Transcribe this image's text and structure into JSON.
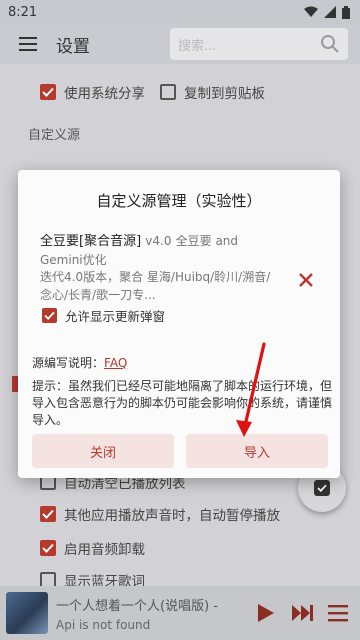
{
  "status": {
    "time": "8:21"
  },
  "appbar": {
    "title": "设置",
    "search_placeholder": "搜索..."
  },
  "settings": {
    "share_system": "使用系统分享",
    "copy_clipboard": "复制到剪贴板",
    "custom_source_title": "自定义源",
    "auto_clear": "自动清空已播放列表",
    "pause_other_app": "其他应用播放声音时，自动暂停播放",
    "enable_uninstall": "启用音频卸载",
    "show_bluetooth_lyric": "显示蓝牙歌词"
  },
  "dialog": {
    "title": "自定义源管理（实验性）",
    "source": {
      "name": "全豆要[聚合音源]",
      "version": "v4.0",
      "author": "全豆要 and Gemini优化",
      "description": "迭代4.0版本，聚合 星海/Huibq/聆川/溯音/念心/长青/歌一刀专..."
    },
    "allow_update_popup": "允许显示更新弹窗",
    "doc_label": "源编写说明：",
    "doc_link": "FAQ",
    "warning": "提示：虽然我们已经尽可能地隔离了脚本的运行环境，但导入包含恶意行为的脚本仍可能会影响你的系统，请谨慎导入。",
    "close_button": "关闭",
    "import_button": "导入"
  },
  "player": {
    "title": "一个人想着一个人(说唱版) -",
    "subtitle": "Api is not found"
  },
  "colors": {
    "accent": "#b5392d",
    "dialog_bg": "#fbfbfb",
    "button_bg": "#f4e3e1"
  },
  "icons": [
    "wifi-icon",
    "signal-icon",
    "battery-icon",
    "menu-icon",
    "search-icon",
    "close-x-icon",
    "check-icon",
    "play-icon",
    "next-icon",
    "playlist-icon"
  ]
}
